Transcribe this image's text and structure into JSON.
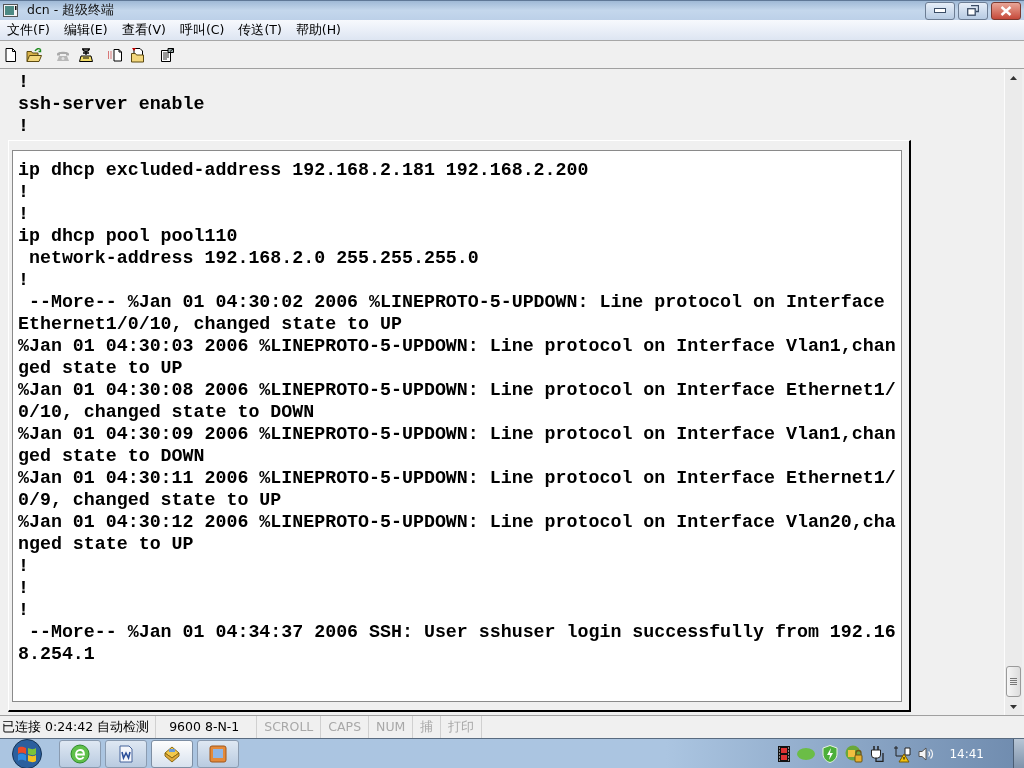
{
  "window": {
    "title": "dcn - 超级终端"
  },
  "menu": [
    {
      "label": "文件(F)"
    },
    {
      "label": "编辑(E)"
    },
    {
      "label": "查看(V)"
    },
    {
      "label": "呼叫(C)"
    },
    {
      "label": "传送(T)"
    },
    {
      "label": "帮助(H)"
    }
  ],
  "toolbar": [
    {
      "kind": "page",
      "disabled": false
    },
    {
      "kind": "folder",
      "disabled": false
    },
    {
      "kind": "phone",
      "disabled": true
    },
    {
      "kind": "handset",
      "disabled": false
    },
    {
      "kind": "send",
      "disabled": false
    },
    {
      "kind": "receive",
      "disabled": false
    },
    {
      "kind": "sheet",
      "disabled": false
    }
  ],
  "terminal": {
    "scrollback": [
      "!",
      "ssh-server enable",
      "!"
    ],
    "screen": [
      "ip dhcp excluded-address 192.168.2.181 192.168.2.200",
      "!",
      "!",
      "ip dhcp pool pool110",
      " network-address 192.168.2.0 255.255.255.0",
      "!",
      " --More-- %Jan 01 04:30:02 2006 %LINEPROTO-5-UPDOWN: Line protocol on Interface",
      "Ethernet1/0/10, changed state to UP",
      "%Jan 01 04:30:03 2006 %LINEPROTO-5-UPDOWN: Line protocol on Interface Vlan1,chan",
      "ged state to UP",
      "%Jan 01 04:30:08 2006 %LINEPROTO-5-UPDOWN: Line protocol on Interface Ethernet1/",
      "0/10, changed state to DOWN",
      "%Jan 01 04:30:09 2006 %LINEPROTO-5-UPDOWN: Line protocol on Interface Vlan1,chan",
      "ged state to DOWN",
      "%Jan 01 04:30:11 2006 %LINEPROTO-5-UPDOWN: Line protocol on Interface Ethernet1/",
      "0/9, changed state to UP",
      "%Jan 01 04:30:12 2006 %LINEPROTO-5-UPDOWN: Line protocol on Interface Vlan20,cha",
      "nged state to UP",
      "!",
      "!",
      "!",
      " --More-- %Jan 01 04:34:37 2006 SSH: User sshuser login successfully from 192.16",
      "8.254.1"
    ]
  },
  "status_bar": [
    {
      "text": "已连接 0:24:42 自动检测",
      "disabled": false
    },
    {
      "text": "9600 8-N-1",
      "disabled": false
    },
    {
      "text": "SCROLL",
      "disabled": true
    },
    {
      "text": "CAPS",
      "disabled": true
    },
    {
      "text": "NUM",
      "disabled": true
    },
    {
      "text": "捕",
      "disabled": true
    },
    {
      "text": "打印",
      "disabled": true
    }
  ],
  "taskbar": {
    "apps": [
      {
        "kind": "globe",
        "selected": false
      },
      {
        "kind": "word",
        "selected": false
      },
      {
        "kind": "terminal",
        "selected": true
      },
      {
        "kind": "picture",
        "selected": false
      }
    ],
    "tray": [
      {
        "kind": "film"
      },
      {
        "kind": "dot"
      },
      {
        "kind": "shield"
      },
      {
        "kind": "lock"
      },
      {
        "kind": "plug"
      },
      {
        "kind": "network"
      },
      {
        "kind": "speaker"
      }
    ],
    "clock": "14:41"
  }
}
